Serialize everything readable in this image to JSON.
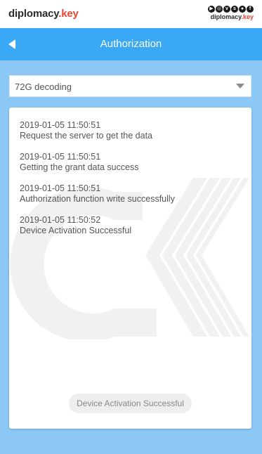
{
  "brand": {
    "logo_main": "diplomacy",
    "logo_dot": ".",
    "logo_key": "key",
    "small_main": "diplomacy",
    "small_dot": ".",
    "small_key": "key",
    "social_icons": [
      "youtube-icon",
      "instagram-icon",
      "vk-icon",
      "skype-icon",
      "whatsapp-icon",
      "facebook-icon"
    ]
  },
  "header": {
    "title": "Authorization",
    "back_icon": "back-arrow-icon"
  },
  "selector": {
    "value": "72G decoding"
  },
  "log": {
    "entries": [
      {
        "time": "2019-01-05 11:50:51",
        "message": "Request the server to get the data"
      },
      {
        "time": "2019-01-05 11:50:51",
        "message": "Getting the grant data success"
      },
      {
        "time": "2019-01-05 11:50:51",
        "message": "Authorization function write successfully"
      },
      {
        "time": "2019-01-05 11:50:52",
        "message": "Device Activation Successful"
      }
    ]
  },
  "toast": {
    "text": "Device Activation Successful"
  },
  "colors": {
    "header": "#3aa9f5",
    "app_background": "#8cc8f5",
    "brand_accent": "#e8462e"
  }
}
